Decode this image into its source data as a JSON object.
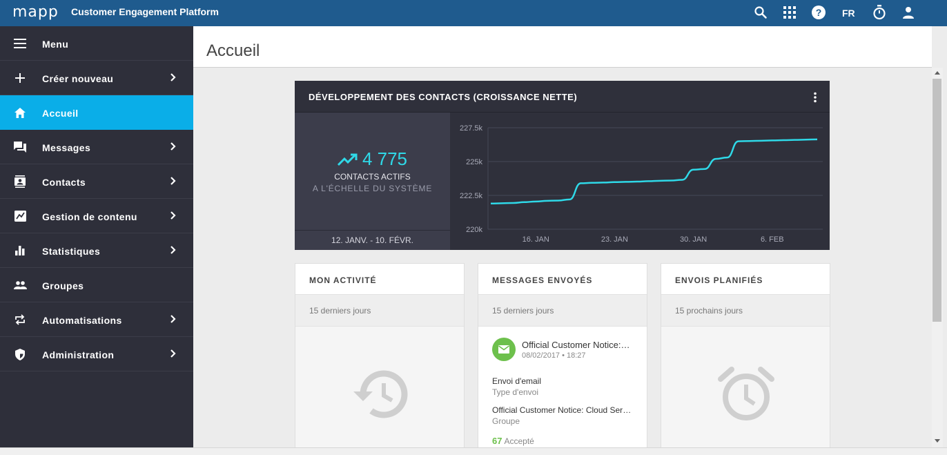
{
  "app": {
    "logo": "mapp",
    "title": "Customer Engagement Platform",
    "language": "FR",
    "icons": [
      "search-icon",
      "apps-grid-icon",
      "help-icon",
      "timer-icon",
      "user-icon"
    ]
  },
  "sidebar": {
    "items": [
      {
        "label": "Menu",
        "icon": "hamburger-icon",
        "has_submenu": false
      },
      {
        "label": "Créer nouveau",
        "icon": "plus-icon",
        "has_submenu": true
      },
      {
        "label": "Accueil",
        "icon": "home-icon",
        "has_submenu": false,
        "active": true
      },
      {
        "label": "Messages",
        "icon": "messages-icon",
        "has_submenu": true
      },
      {
        "label": "Contacts",
        "icon": "contacts-icon",
        "has_submenu": true
      },
      {
        "label": "Gestion de contenu",
        "icon": "content-icon",
        "has_submenu": true
      },
      {
        "label": "Statistiques",
        "icon": "bar-chart-icon",
        "has_submenu": true
      },
      {
        "label": "Groupes",
        "icon": "groups-icon",
        "has_submenu": false
      },
      {
        "label": "Automatisations",
        "icon": "repeat-icon",
        "has_submenu": true
      },
      {
        "label": "Administration",
        "icon": "shield-icon",
        "has_submenu": true
      }
    ],
    "active_color": "#0aaee8"
  },
  "page": {
    "title": "Accueil"
  },
  "contacts_widget": {
    "title": "DÉVELOPPEMENT DES CONTACTS (CROISSANCE NETTE)",
    "growth_value": "4 775",
    "growth_label": "CONTACTS ACTIFS",
    "scope_label": "A L'ÉCHELLE DU SYSTÈME",
    "date_range": "12. JANV. - 10. FÉVR.",
    "accent_color": "#2fd9e8"
  },
  "chart_data": {
    "type": "line",
    "title": "",
    "xlabel": "",
    "ylabel": "",
    "ylim": [
      220000,
      227500
    ],
    "y_ticks": [
      "227.5k",
      "225k",
      "222.5k",
      "220k"
    ],
    "x_ticks": [
      "16. JAN",
      "23. JAN",
      "30. JAN",
      "6. FEB"
    ],
    "grid": true,
    "series": [
      {
        "x": [
          "2017-01-12",
          "2017-01-13",
          "2017-01-14",
          "2017-01-15",
          "2017-01-16",
          "2017-01-17",
          "2017-01-18",
          "2017-01-19",
          "2017-01-20",
          "2017-01-21",
          "2017-01-22",
          "2017-01-23",
          "2017-01-24",
          "2017-01-25",
          "2017-01-26",
          "2017-01-27",
          "2017-01-28",
          "2017-01-29",
          "2017-01-30",
          "2017-01-31",
          "2017-02-01",
          "2017-02-02",
          "2017-02-03",
          "2017-02-04",
          "2017-02-05",
          "2017-02-06",
          "2017-02-07",
          "2017-02-08",
          "2017-02-09",
          "2017-02-10"
        ],
        "values": [
          221900,
          221920,
          221940,
          222000,
          222050,
          222100,
          222120,
          222200,
          223400,
          223430,
          223450,
          223480,
          223500,
          223520,
          223550,
          223580,
          223600,
          223650,
          224400,
          224450,
          225200,
          225300,
          226500,
          226520,
          226540,
          226560,
          226580,
          226600,
          226620,
          226640
        ]
      }
    ]
  },
  "cards": [
    {
      "title": "MON ACTIVITÉ",
      "subtitle": "15 derniers jours",
      "empty_icon": "history-icon"
    },
    {
      "title": "MESSAGES ENVOYÉS",
      "subtitle": "15 derniers jours",
      "message": {
        "icon": "mail-icon",
        "title": "Official Customer Notice: Cloud Services",
        "date": "08/02/2017 • 18:27",
        "send_type_value": "Envoi d'email",
        "send_type_label": "Type d'envoi",
        "group_value": "Official Customer Notice: Cloud Services",
        "group_label": "Groupe",
        "accepted_count": "67",
        "accepted_label": "Accepté"
      }
    },
    {
      "title": "ENVOIS PLANIFIÉS",
      "subtitle": "15 prochains jours",
      "empty_icon": "alarm-icon"
    }
  ]
}
